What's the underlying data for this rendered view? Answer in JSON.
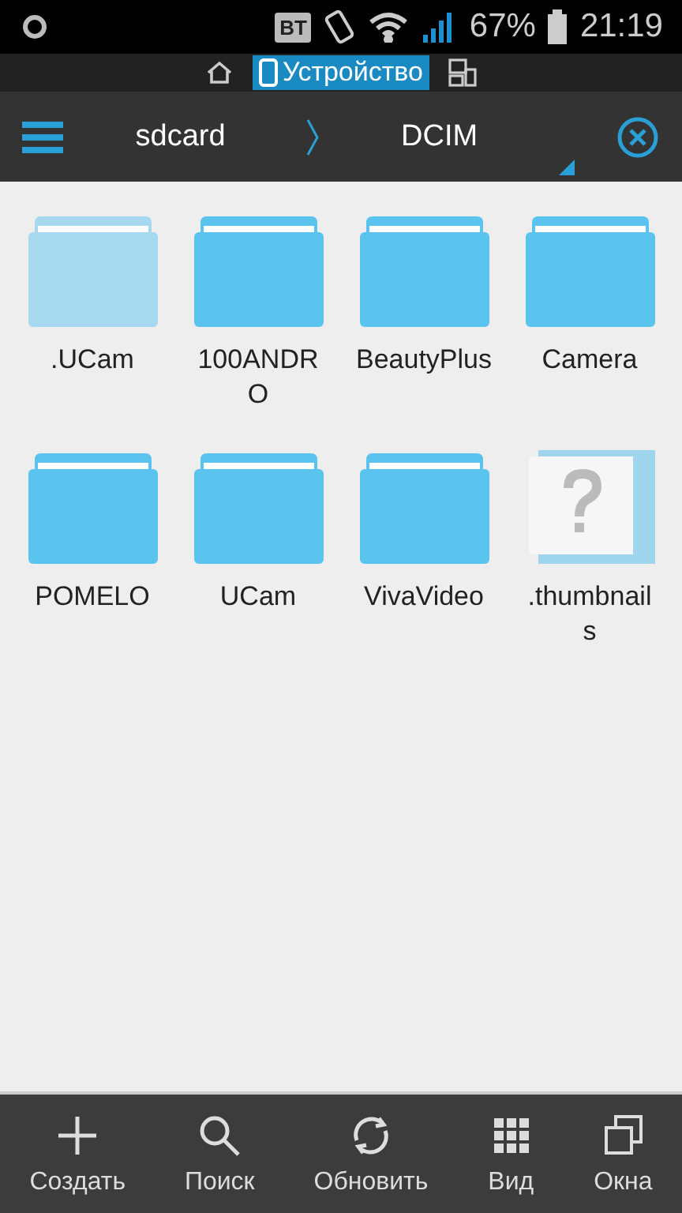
{
  "status_bar": {
    "carrier_badge": "BT",
    "battery": "67%",
    "time": "21:19"
  },
  "location_bar": {
    "items": [
      {
        "kind": "home",
        "selected": false
      },
      {
        "kind": "device",
        "label": "Устройство",
        "selected": true
      },
      {
        "kind": "network",
        "selected": false
      }
    ]
  },
  "header": {
    "path": [
      "sdcard",
      "DCIM"
    ]
  },
  "files": [
    {
      "name": ".UCam",
      "kind": "folder",
      "hidden": true
    },
    {
      "name": "100ANDRO",
      "kind": "folder",
      "hidden": false
    },
    {
      "name": "BeautyPlus",
      "kind": "folder",
      "hidden": false
    },
    {
      "name": "Camera",
      "kind": "folder",
      "hidden": false
    },
    {
      "name": "POMELO",
      "kind": "folder",
      "hidden": false
    },
    {
      "name": "UCam",
      "kind": "folder",
      "hidden": false
    },
    {
      "name": "VivaVideo",
      "kind": "folder",
      "hidden": false
    },
    {
      "name": ".thumbnails",
      "kind": "unknown"
    }
  ],
  "toolbar": [
    {
      "label": "Создать",
      "kind": "create"
    },
    {
      "label": "Поиск",
      "kind": "search"
    },
    {
      "label": "Обновить",
      "kind": "refresh"
    },
    {
      "label": "Вид",
      "kind": "view"
    },
    {
      "label": "Окна",
      "kind": "windows"
    }
  ]
}
